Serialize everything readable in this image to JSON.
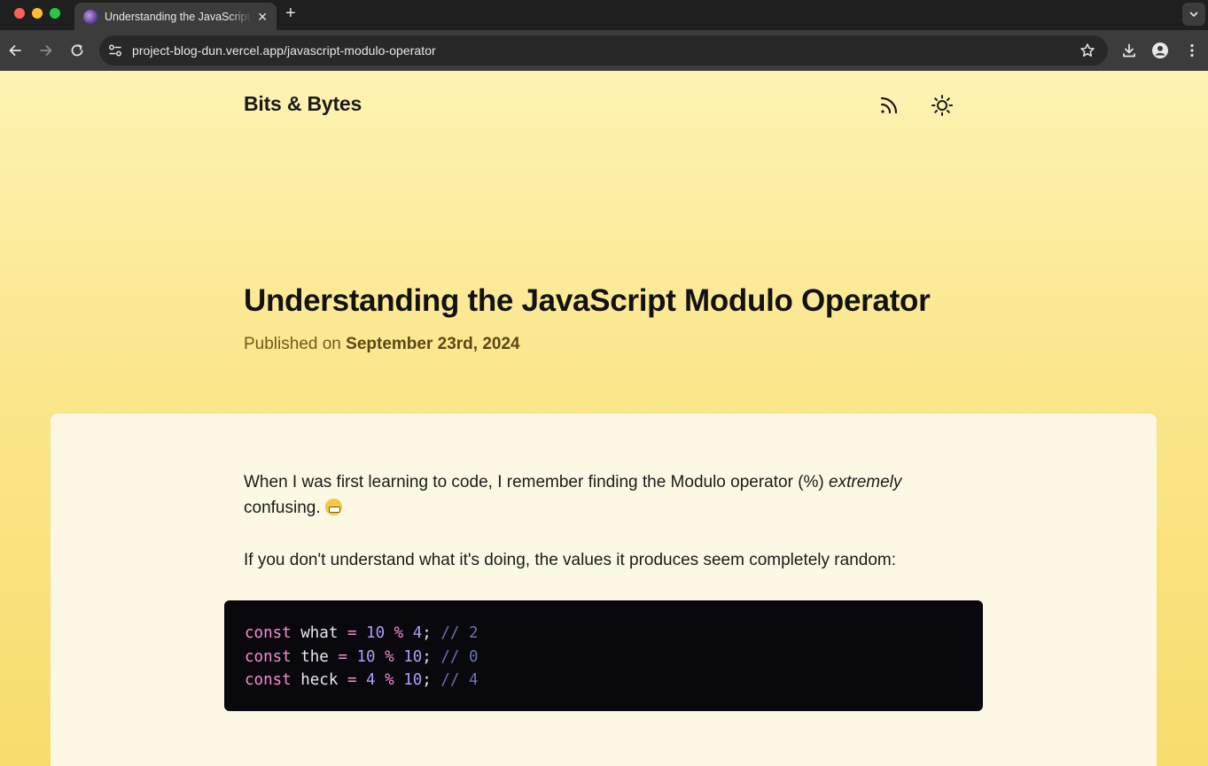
{
  "browser": {
    "tab_title": "Understanding the JavaScript Modulo Operator",
    "tab_close": "✕",
    "new_tab": "+",
    "url": "project-blog-dun.vercel.app/javascript-modulo-operator"
  },
  "site": {
    "title": "Bits & Bytes"
  },
  "post": {
    "title": "Understanding the JavaScript Modulo Operator",
    "published_prefix": "Published on ",
    "published_date": "September 23rd, 2024",
    "intro_before": "When I was first learning to code, I remember finding the Modulo operator (%) ",
    "intro_em": "extremely",
    "intro_after": " confusing. ",
    "second_para": "If you don't understand what it's doing, the values it produces seem completely random:"
  },
  "code": {
    "lines": [
      {
        "kw": "const",
        "name": "what",
        "eq": "=",
        "a": "10",
        "op": "%",
        "b": "4",
        "semi": ";",
        "comment": "// 2"
      },
      {
        "kw": "const",
        "name": "the",
        "eq": "=",
        "a": "10",
        "op": "%",
        "b": "10",
        "semi": ";",
        "comment": "// 0"
      },
      {
        "kw": "const",
        "name": "heck",
        "eq": "=",
        "a": "4",
        "op": "%",
        "b": "10",
        "semi": ";",
        "comment": "// 4"
      }
    ]
  },
  "icons": {
    "rss": "rss-icon",
    "theme": "sun-icon",
    "emoji": "grimacing-face-icon"
  }
}
